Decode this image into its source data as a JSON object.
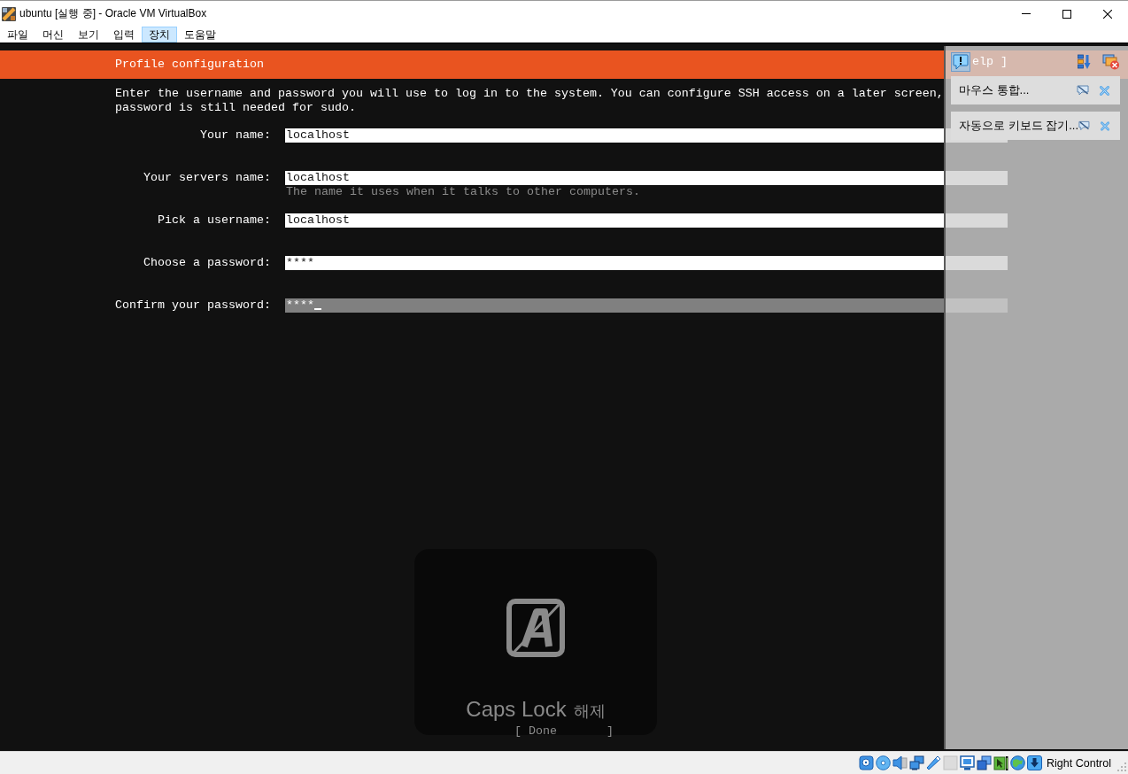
{
  "window": {
    "title": "ubuntu [실행 중] - Oracle VM VirtualBox"
  },
  "menu": [
    {
      "label": "파일",
      "selected": false
    },
    {
      "label": "머신",
      "selected": false
    },
    {
      "label": "보기",
      "selected": false
    },
    {
      "label": "입력",
      "selected": false
    },
    {
      "label": "장치",
      "selected": true
    },
    {
      "label": "도움말",
      "selected": false
    }
  ],
  "installer": {
    "title": "Profile configuration",
    "help_button": "elp ]",
    "intro": [
      "Enter the username and password you will use to log in to the system. You can configure SSH access on a later screen,",
      "password is still needed for sudo."
    ],
    "fields": [
      {
        "label": "Your name:",
        "value": "localhost",
        "focused": false
      },
      {
        "label": "Your servers name:",
        "value": "localhost",
        "hint": "The name it uses when it talks to other computers.",
        "focused": false
      },
      {
        "label": "Pick a username:",
        "value": "localhost",
        "focused": false
      },
      {
        "label": "Choose a password:",
        "value": "****",
        "focused": false
      },
      {
        "label": "Confirm your password:",
        "value": "****",
        "focused": true
      }
    ],
    "done_button": "[ Done       ]"
  },
  "caps_lock_popup": {
    "label": "Caps Lock",
    "state": "해제"
  },
  "notifications": [
    {
      "text": "마우스 통합..."
    },
    {
      "text": "자동으로 키보드 잡기..."
    }
  ],
  "status_bar": {
    "host_key": "Right Control"
  }
}
